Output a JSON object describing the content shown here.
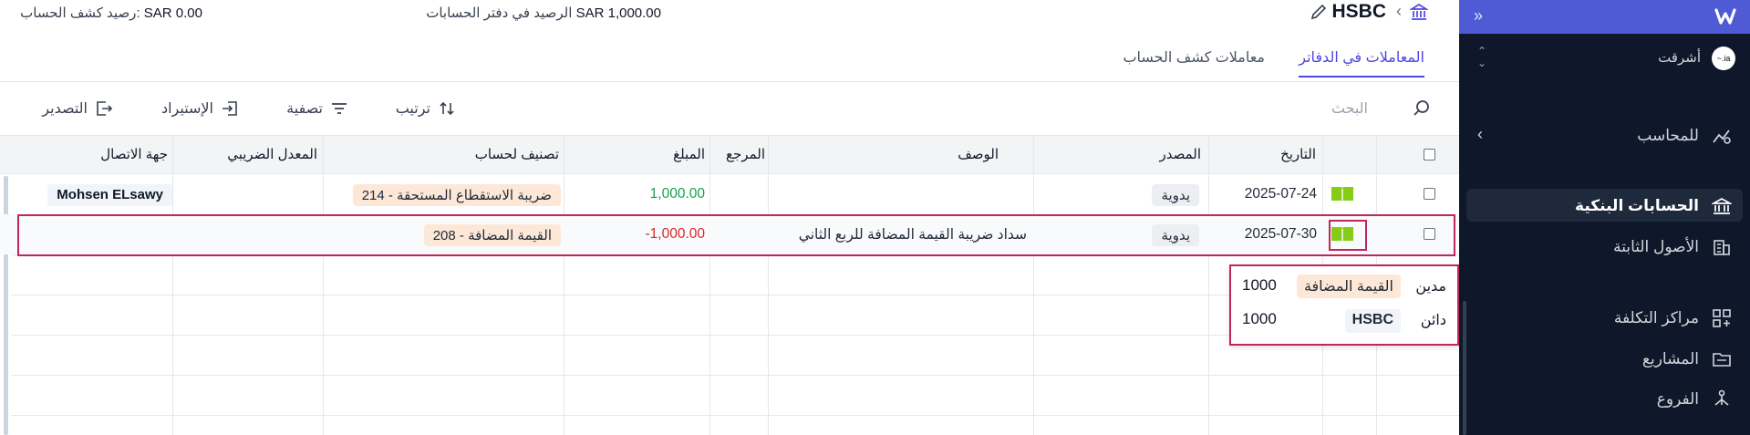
{
  "sidebar": {
    "org_name": "أشرقت",
    "org_avatar_text": "~.ia",
    "items": [
      {
        "label": "للمحاسب",
        "icon": "accountant-icon"
      },
      {
        "label": "الحسابات البنكية",
        "icon": "bank-icon"
      },
      {
        "label": "الأصول الثابتة",
        "icon": "building-icon"
      },
      {
        "label": "مراكز التكلفة",
        "icon": "grid-plus-icon"
      },
      {
        "label": "المشاريع",
        "icon": "folder-icon"
      },
      {
        "label": "الفروع",
        "icon": "branches-icon"
      }
    ],
    "colors": {
      "top_bar": "#4f5bd5",
      "background": "#0f172a"
    }
  },
  "header": {
    "title": "HSBC",
    "ledger_balance_label": "الرصيد في دفتر الحسابات",
    "ledger_balance_value": "SAR 1,000.00",
    "statement_balance_label": "رصيد كشف الحساب:",
    "statement_balance_value": "SAR 0.00"
  },
  "tabs": [
    {
      "label": "المعاملات في الدفاتر",
      "active": true
    },
    {
      "label": "معاملات كشف الحساب",
      "active": false
    }
  ],
  "toolbar": {
    "search_placeholder": "البحث",
    "sort_label": "ترتيب",
    "filter_label": "تصفية",
    "import_label": "الإستيراد",
    "export_label": "التصدير"
  },
  "table": {
    "headers": {
      "date": "التاريخ",
      "source": "المصدر",
      "description": "الوصف",
      "reference": "المرجع",
      "amount": "المبلغ",
      "account": "تصنيف لحساب",
      "tax_rate": "المعدل الضريبي",
      "contact": "جهة الاتصال"
    },
    "rows": [
      {
        "date": "2025-07-24",
        "source": "يدوية",
        "description": "",
        "reference": "",
        "amount": "1,000.00",
        "account": "214 - ضريبة الاستقطاع المستحقة",
        "tax_rate": "",
        "contact": "Mohsen ELsawy"
      },
      {
        "date": "2025-07-30",
        "source": "يدوية",
        "description": "سداد ضريبة القيمة المضافة للربع الثاني",
        "reference": "",
        "amount": "-1,000.00",
        "account": "208 - القيمة المضافة",
        "tax_rate": "",
        "contact": ""
      }
    ]
  },
  "journal_popup": {
    "debit_label": "مدين",
    "debit_account": "القيمة المضافة",
    "debit_amount": "1000",
    "credit_label": "دائن",
    "credit_account": "HSBC",
    "credit_amount": "1000"
  },
  "colors": {
    "accent": "#4f46e5",
    "highlight": "#c0265d",
    "positive": "#16a34a",
    "negative": "#dc2626",
    "book": "#84cc16"
  }
}
